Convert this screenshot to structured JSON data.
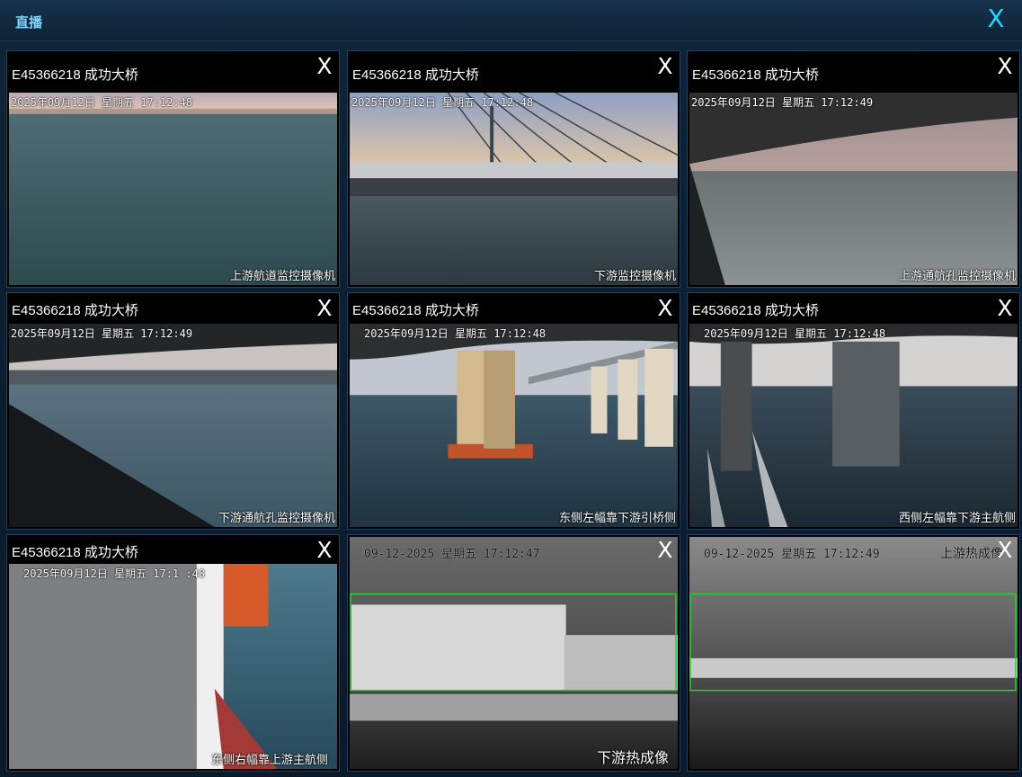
{
  "header": {
    "title": "直播",
    "close_label": "X"
  },
  "tiles": [
    {
      "name": "E45366218 成功大桥",
      "close": "X",
      "osd": "2025年09月12日  星期五  17:12:48",
      "caption": "上游航道监控摄像机"
    },
    {
      "name": "E45366218 成功大桥",
      "close": "X",
      "osd": "2025年09月12日  星期五  17:12:48",
      "caption": "下游监控摄像机"
    },
    {
      "name": "E45366218 成功大桥",
      "close": "X",
      "osd": "2025年09月12日  星期五  17:12:49",
      "caption": "上游通航孔监控摄像机"
    },
    {
      "name": "E45366218 成功大桥",
      "close": "X",
      "osd": "2025年09月12日  星期五  17:12:49",
      "caption": "下游通航孔监控摄像机"
    },
    {
      "name": "E45366218 成功大桥",
      "close": "X",
      "osd": "2025年09月12日  星期五  17:12:48",
      "caption": "东侧左幅靠下游引桥侧"
    },
    {
      "name": "E45366218 成功大桥",
      "close": "X",
      "osd": "2025年09月12日  星期五  17:12:48",
      "caption": "西侧左幅靠下游主航侧"
    },
    {
      "name": "E45366218 成功大桥",
      "close": "X",
      "osd": "2025年09月12日  星期五  17:1  :48",
      "caption": "东侧右幅靠上游主航侧"
    },
    {
      "name": "",
      "close": "X",
      "osd": "09-12-2025  星期五  17:12:47",
      "caption": "下游热成像"
    },
    {
      "name": "",
      "close": "X",
      "osd": "09-12-2025  星期五  17:12:49",
      "caption": "上游热成像"
    }
  ]
}
